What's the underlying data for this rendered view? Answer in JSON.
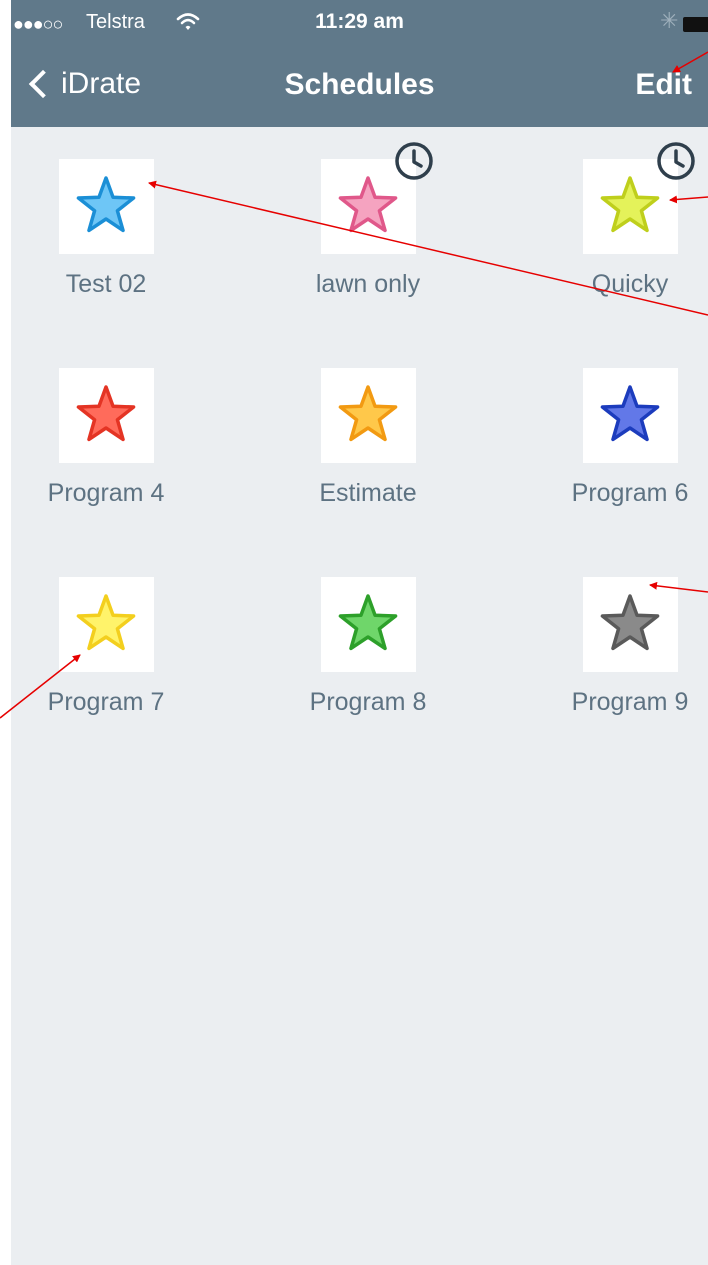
{
  "status_bar": {
    "signal_dots": "●●●○○",
    "carrier": "Telstra",
    "time": "11:29 am",
    "icons": [
      "wifi-icon",
      "bluetooth-icon",
      "battery-icon"
    ]
  },
  "nav": {
    "back_label": "iDrate",
    "title": "Schedules",
    "edit_label": "Edit"
  },
  "colors": {
    "nav_background": "#60798a",
    "content_background": "#ebeef1",
    "label_text": "#5d7282",
    "annotation_arrow": "#e60000"
  },
  "schedules": [
    {
      "label": "Test 02",
      "star_fill": "#6ec6f6",
      "star_stroke": "#1b8fd6",
      "scheduled": false
    },
    {
      "label": "lawn only",
      "star_fill": "#f5a3c0",
      "star_stroke": "#e0588a",
      "scheduled": true
    },
    {
      "label": "Quicky",
      "star_fill": "#e4f25a",
      "star_stroke": "#bfcf1c",
      "scheduled": true
    },
    {
      "label": "Program 4",
      "star_fill": "#ff6b5b",
      "star_stroke": "#e43424",
      "scheduled": false
    },
    {
      "label": "Estimate",
      "star_fill": "#ffc84a",
      "star_stroke": "#f29a12",
      "scheduled": false
    },
    {
      "label": "Program 6",
      "star_fill": "#6278e8",
      "star_stroke": "#1c3cbd",
      "scheduled": false
    },
    {
      "label": "Program 7",
      "star_fill": "#fff36a",
      "star_stroke": "#f3cf1e",
      "scheduled": false
    },
    {
      "label": "Program 8",
      "star_fill": "#6fd66a",
      "star_stroke": "#2da02a",
      "scheduled": false
    },
    {
      "label": "Program 9",
      "star_fill": "#8a8a8a",
      "star_stroke": "#5a5a5a",
      "scheduled": false
    }
  ]
}
